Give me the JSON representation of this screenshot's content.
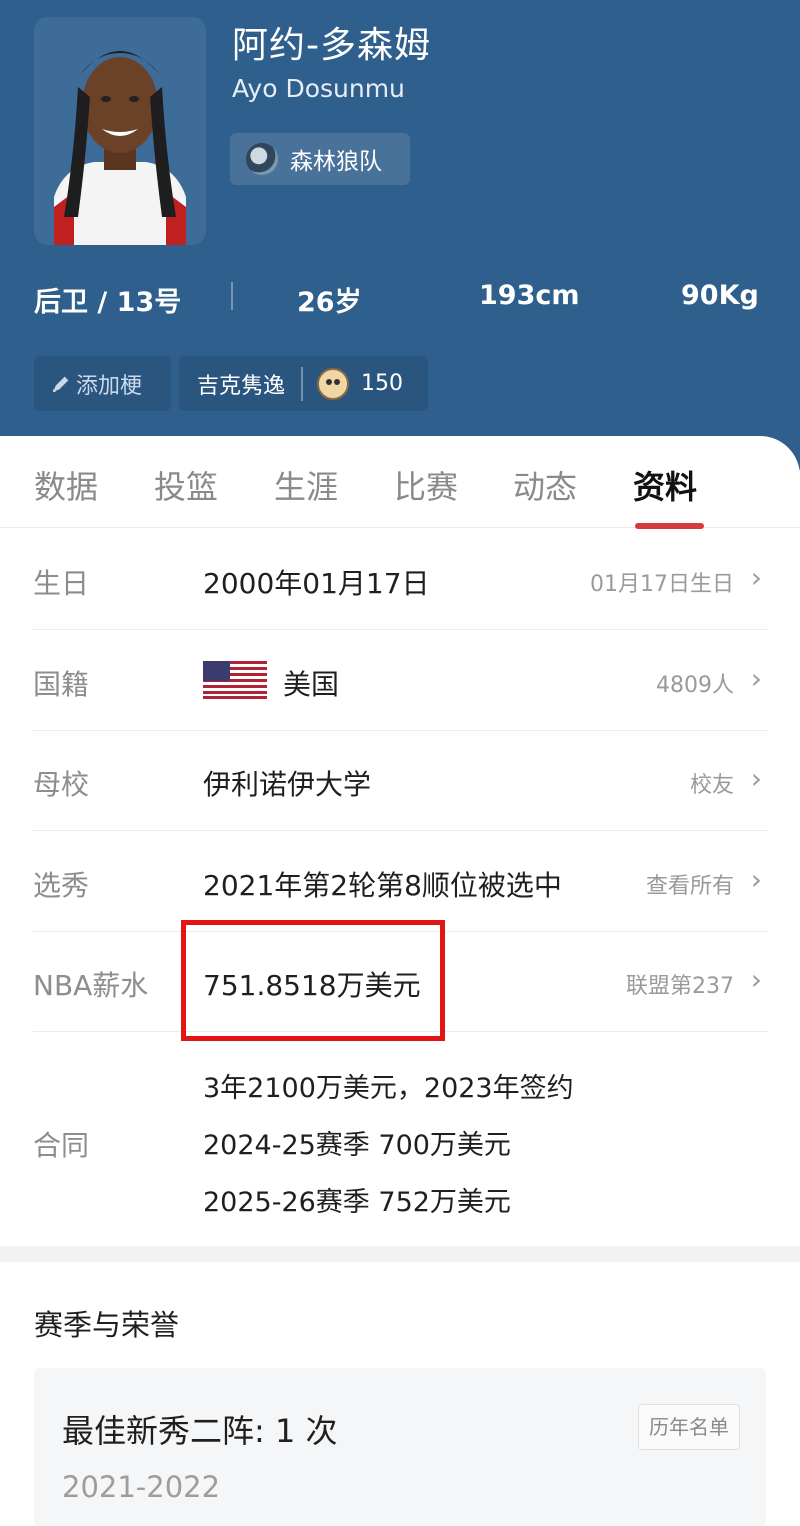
{
  "player": {
    "name_cn": "阿约-多森姆",
    "name_en": "Ayo Dosunmu",
    "team": "森林狼队",
    "position_number": "后卫 / 13号",
    "age": "26岁",
    "height": "193cm",
    "weight": "90Kg"
  },
  "chips": {
    "add_meme": "添加梗",
    "meme_name": "吉克隽逸",
    "meme_count": "150"
  },
  "tabs": [
    "数据",
    "投篮",
    "生涯",
    "比赛",
    "动态",
    "资料"
  ],
  "active_tab": "资料",
  "profile": {
    "birthday": {
      "label": "生日",
      "value": "2000年01月17日",
      "right": "01月17日生日"
    },
    "nationality": {
      "label": "国籍",
      "value": "美国",
      "right": "4809人"
    },
    "college": {
      "label": "母校",
      "value": "伊利诺伊大学",
      "right": "校友"
    },
    "draft": {
      "label": "选秀",
      "value": "2021年第2轮第8顺位被选中",
      "right": "查看所有"
    },
    "salary": {
      "label": "NBA薪水",
      "value": "751.8518万美元",
      "right": "联盟第237"
    },
    "contract": {
      "label": "合同",
      "lines": [
        "3年2100万美元，2023年签约",
        "2024-25赛季 700万美元",
        "2025-26赛季 752万美元"
      ]
    }
  },
  "honors": {
    "section_title": "赛季与荣誉",
    "title": "最佳新秀二阵: 1 次",
    "year": "2021-2022",
    "history_button": "历年名单"
  },
  "colors": {
    "header_bg": "#2f5f8d",
    "active_underline": "#d63a3a",
    "highlight_box": "#e31414"
  }
}
